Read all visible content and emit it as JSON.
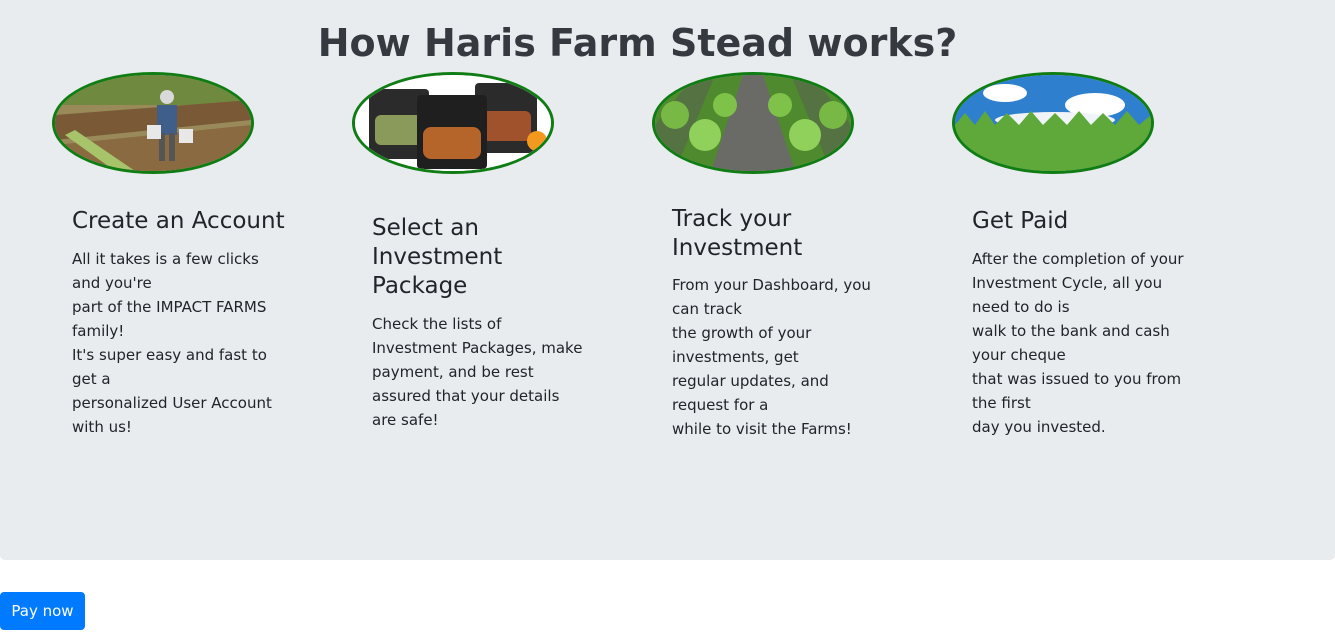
{
  "page_title": "How Haris Farm Stead works?",
  "steps": [
    {
      "title": "Create an Account",
      "desc": "All it takes is a few clicks and you're\npart of the IMPACT FARMS family!\nIt's super easy and fast to get a\npersonalized User Account with us!",
      "image": "farmer-watering-image"
    },
    {
      "title": "Select an Investment Package",
      "desc": "Check the lists of Investment Packages, make payment, and be rest\nassured that your details are safe!",
      "image": "food-packages-image"
    },
    {
      "title": "Track your Investment",
      "desc": "From your Dashboard, you can track\nthe growth of your investments, get\nregular updates, and request for a\nwhile to visit the Farms!",
      "image": "crop-rows-image"
    },
    {
      "title": "Get Paid",
      "desc": "After the completion of your Investment Cycle, all you need to do is\nwalk to the bank and cash your cheque\nthat was issued to you from the first\nday you invested.",
      "image": "cornfield-sky-image"
    }
  ],
  "pay_button": {
    "label": "Pay now"
  },
  "colors": {
    "accent": "#007bff",
    "image_border": "#0f7d13",
    "panel_bg": "#e9ecef"
  }
}
